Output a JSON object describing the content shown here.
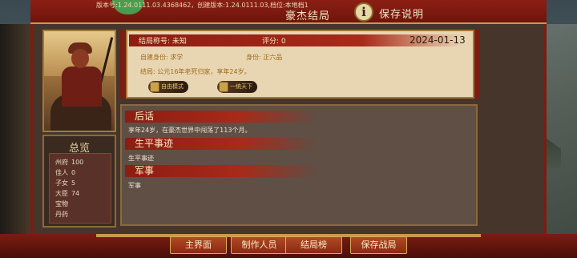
{
  "header": {
    "version_text": "版本号:1.24.0111.03.4368462，创建版本:1.24.0111.03,档位:本地档1",
    "title": "豪杰结局",
    "info_icon": "info-icon",
    "save_note": "保存说明"
  },
  "result": {
    "name_label": "结局称号: 未知",
    "score_label": "评分: 0",
    "date": "2024-01-13",
    "identity_label": "自建身份: 求学",
    "rank_label": "身份: 正六品",
    "ending_label": "结局: 公元16年老死归家，享年24岁。",
    "tag_free": "自由模式",
    "tag_mode": "一统天下"
  },
  "overview": {
    "title": "总览",
    "stats": [
      {
        "label": "州府",
        "value": "100"
      },
      {
        "label": "佳人",
        "value": "0"
      },
      {
        "label": "子女",
        "value": "5"
      },
      {
        "label": "大臣",
        "value": "74"
      },
      {
        "label": "宝物",
        "value": ""
      },
      {
        "label": "丹药",
        "value": ""
      }
    ]
  },
  "sections": {
    "epilogue_title": "后话",
    "epilogue_text": "享年24岁，在豪杰世界中闯荡了113个月。",
    "life_title": "生平事迹",
    "life_text": "生平事迹",
    "military_title": "军事",
    "military_text": "军事"
  },
  "bottom_nav": {
    "main": "主界面",
    "credits": "制作人员",
    "ranking": "结局榜",
    "save": "保存战局"
  }
}
